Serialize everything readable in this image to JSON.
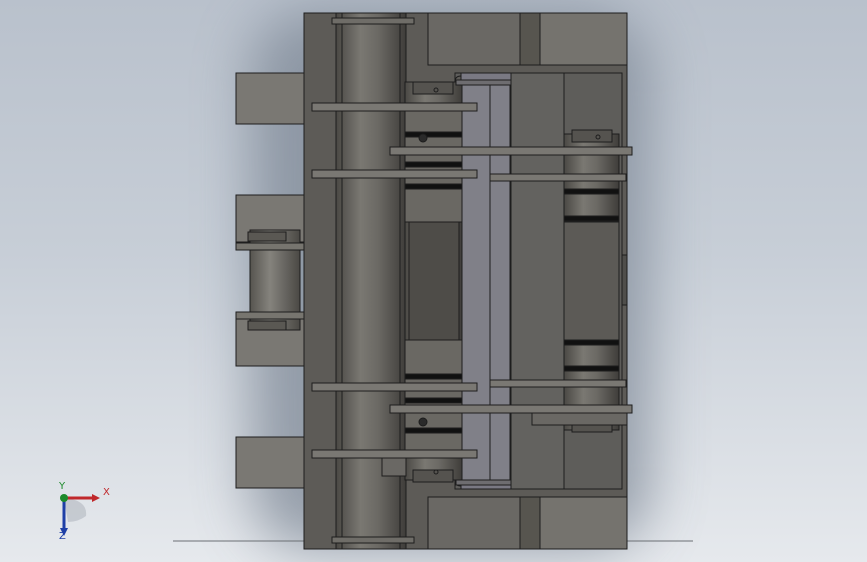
{
  "viewport": {
    "background_top": "#b9c1cc",
    "background_bottom": "#e6e9ed",
    "model_dark": "#4f4d49",
    "model_mid": "#6e6c67",
    "model_light": "#8a8882",
    "edge_color": "#1d1d1d",
    "shadow_color": "#7d8795"
  },
  "triad": {
    "x_label": "X",
    "y_label": "Y",
    "z_label": "Z",
    "x_color": "#c0282b",
    "y_color": "#1c8a2b",
    "z_color": "#1e3fa6"
  }
}
